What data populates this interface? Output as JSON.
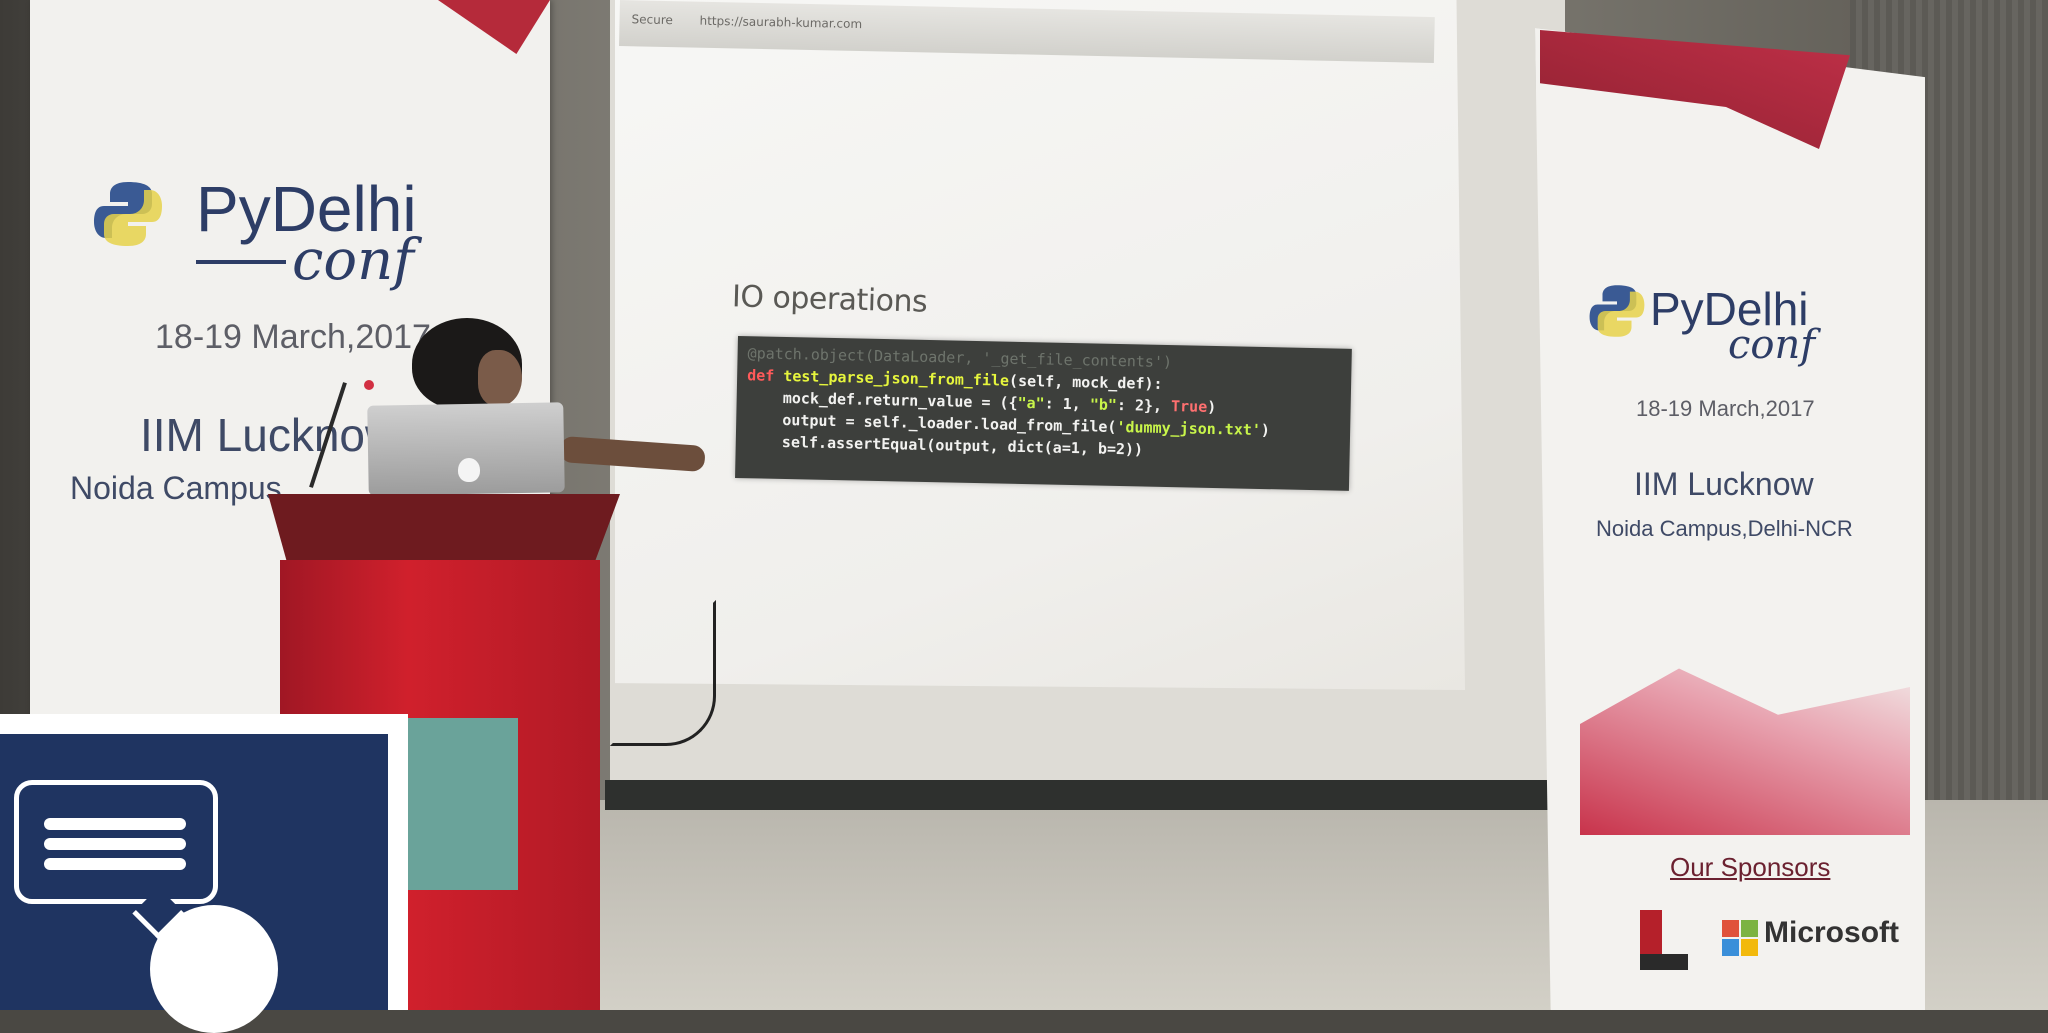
{
  "slide": {
    "browser_secure": "Secure",
    "browser_url": "https://saurabh-kumar.com",
    "title": "IO operations",
    "code": {
      "decorator": "@patch.object(DataLoader, '_get_file_contents')",
      "line1_def": "def ",
      "line1_fn": "test_parse_json_from_file",
      "line1_rest": "(self, mock_def):",
      "line2_a": "    mock_def.return_value = ({",
      "line2_s1": "\"a\"",
      "line2_b": ": 1, ",
      "line2_s2": "\"b\"",
      "line2_c": ": 2}, ",
      "line2_true": "True",
      "line2_d": ")",
      "line3_a": "    output = self._loader.load_from_file(",
      "line3_s": "'dummy_json.txt'",
      "line3_b": ")",
      "line4": "    self.assertEqual(output, dict(a=1, b=2))"
    }
  },
  "banner_left": {
    "brand": "PyDelhi",
    "conf": "conf",
    "dates": "18-19 March,2017",
    "venue": "IIM Lucknow",
    "campus": "Noida Campus"
  },
  "banner_right": {
    "brand": "PyDelhi",
    "conf": "conf",
    "dates": "18-19 March,2017",
    "venue": "IIM Lucknow",
    "campus": "Noida Campus,Delhi-NCR",
    "sponsors_title": "Our Sponsors",
    "sponsor_ms": "Microsoft"
  },
  "colors": {
    "brand_navy": "#2d3d66",
    "podium_red": "#d0202c",
    "overlay_navy": "#1f3461"
  },
  "icons": {
    "overlay": "chat-bubble-icon"
  }
}
